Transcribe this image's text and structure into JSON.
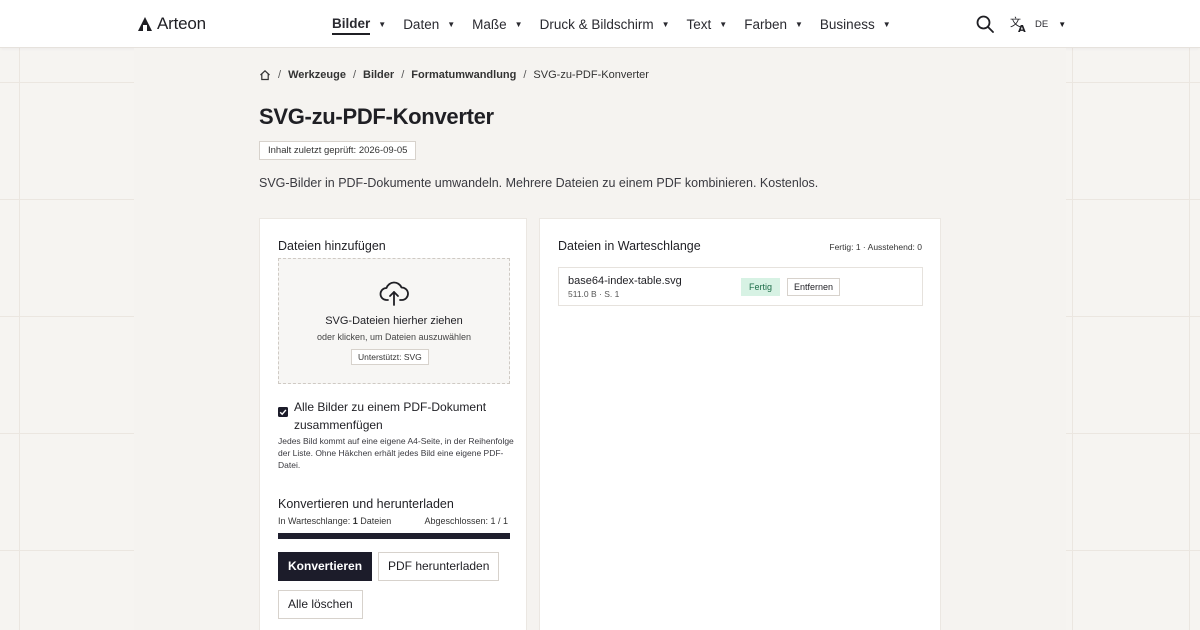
{
  "header": {
    "logo_text": "Arteon",
    "nav": [
      {
        "label": "Bilder",
        "active": true
      },
      {
        "label": "Daten"
      },
      {
        "label": "Maße"
      },
      {
        "label": "Druck & Bildschirm"
      },
      {
        "label": "Text"
      },
      {
        "label": "Farben"
      },
      {
        "label": "Business"
      }
    ],
    "language": "DE"
  },
  "breadcrumb": [
    "Werkzeuge",
    "Bilder",
    "Formatumwandlung",
    "SVG-zu-PDF-Konverter"
  ],
  "page": {
    "title": "SVG-zu-PDF-Konverter",
    "reviewed": "Inhalt zuletzt geprüft: 2026-09-05",
    "subtitle": "SVG-Bilder in PDF-Dokumente umwandeln. Mehrere Dateien zu einem PDF kombinieren. Kostenlos."
  },
  "upload": {
    "title": "Dateien hinzufügen",
    "drop_title": "SVG-Dateien hierher ziehen",
    "drop_sub": "oder klicken, um Dateien auszuwählen",
    "supports": "Unterstützt: SVG",
    "merge_label": "Alle Bilder zu einem PDF-Dokument zusammenfügen",
    "merge_checked": true,
    "merge_help": "Jedes Bild kommt auf eine eigene A4-Seite, in der Reihenfolge der Liste. Ohne Häkchen erhält jedes Bild eine eigene PDF-Datei."
  },
  "convert": {
    "title": "Konvertieren und herunterladen",
    "queue_prefix": "In Warteschlange: ",
    "queue_count": "1",
    "queue_suffix": " Dateien",
    "done": "Abgeschlossen: 1 / 1",
    "progress": 1.0,
    "convert_label": "Konvertieren",
    "download_label": "PDF herunterladen",
    "clear_label": "Alle löschen"
  },
  "queue": {
    "title": "Dateien in Warteschlange",
    "stats": "Fertig: 1 · Ausstehend: 0",
    "files": [
      {
        "name": "base64-index-table.svg",
        "meta": "511.0 B · S. 1",
        "status": "Fertig",
        "remove_label": "Entfernen"
      }
    ]
  },
  "colors": {
    "primary": "#1c1c2a",
    "status_done_bg": "#d7f2e4",
    "status_done_text": "#1f6e4a",
    "page_bg": "#f6f4f1"
  }
}
